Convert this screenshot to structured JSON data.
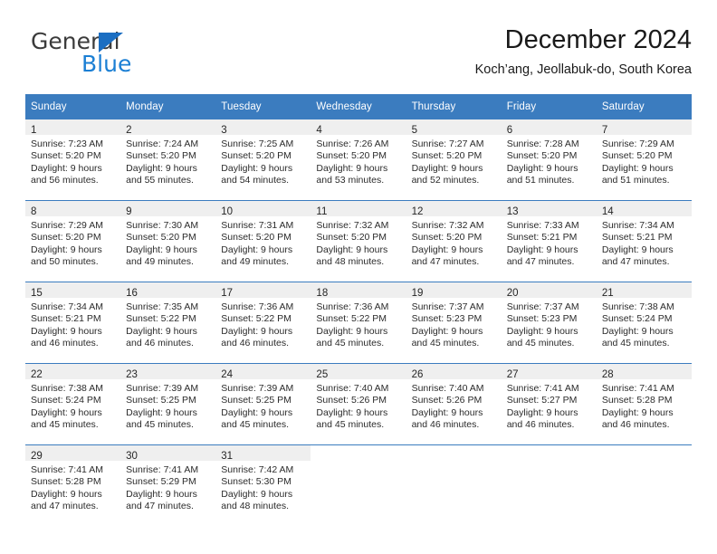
{
  "brand": {
    "name_part1": "General",
    "name_part2": "Blue",
    "triangle_icon": "triangle-icon"
  },
  "header": {
    "month_title": "December 2024",
    "location": "Koch’ang, Jeollabuk-do, South Korea"
  },
  "colors": {
    "header_blue": "#3b7cbf",
    "brand_blue": "#1b7fd4",
    "daynum_strip": "#efefef",
    "text": "#2b2b2b"
  },
  "calendar": {
    "weekday_headers": [
      "Sunday",
      "Monday",
      "Tuesday",
      "Wednesday",
      "Thursday",
      "Friday",
      "Saturday"
    ],
    "weeks": [
      [
        {
          "day": "1",
          "sunrise": "Sunrise: 7:23 AM",
          "sunset": "Sunset: 5:20 PM",
          "daylight1": "Daylight: 9 hours",
          "daylight2": "and 56 minutes."
        },
        {
          "day": "2",
          "sunrise": "Sunrise: 7:24 AM",
          "sunset": "Sunset: 5:20 PM",
          "daylight1": "Daylight: 9 hours",
          "daylight2": "and 55 minutes."
        },
        {
          "day": "3",
          "sunrise": "Sunrise: 7:25 AM",
          "sunset": "Sunset: 5:20 PM",
          "daylight1": "Daylight: 9 hours",
          "daylight2": "and 54 minutes."
        },
        {
          "day": "4",
          "sunrise": "Sunrise: 7:26 AM",
          "sunset": "Sunset: 5:20 PM",
          "daylight1": "Daylight: 9 hours",
          "daylight2": "and 53 minutes."
        },
        {
          "day": "5",
          "sunrise": "Sunrise: 7:27 AM",
          "sunset": "Sunset: 5:20 PM",
          "daylight1": "Daylight: 9 hours",
          "daylight2": "and 52 minutes."
        },
        {
          "day": "6",
          "sunrise": "Sunrise: 7:28 AM",
          "sunset": "Sunset: 5:20 PM",
          "daylight1": "Daylight: 9 hours",
          "daylight2": "and 51 minutes."
        },
        {
          "day": "7",
          "sunrise": "Sunrise: 7:29 AM",
          "sunset": "Sunset: 5:20 PM",
          "daylight1": "Daylight: 9 hours",
          "daylight2": "and 51 minutes."
        }
      ],
      [
        {
          "day": "8",
          "sunrise": "Sunrise: 7:29 AM",
          "sunset": "Sunset: 5:20 PM",
          "daylight1": "Daylight: 9 hours",
          "daylight2": "and 50 minutes."
        },
        {
          "day": "9",
          "sunrise": "Sunrise: 7:30 AM",
          "sunset": "Sunset: 5:20 PM",
          "daylight1": "Daylight: 9 hours",
          "daylight2": "and 49 minutes."
        },
        {
          "day": "10",
          "sunrise": "Sunrise: 7:31 AM",
          "sunset": "Sunset: 5:20 PM",
          "daylight1": "Daylight: 9 hours",
          "daylight2": "and 49 minutes."
        },
        {
          "day": "11",
          "sunrise": "Sunrise: 7:32 AM",
          "sunset": "Sunset: 5:20 PM",
          "daylight1": "Daylight: 9 hours",
          "daylight2": "and 48 minutes."
        },
        {
          "day": "12",
          "sunrise": "Sunrise: 7:32 AM",
          "sunset": "Sunset: 5:20 PM",
          "daylight1": "Daylight: 9 hours",
          "daylight2": "and 47 minutes."
        },
        {
          "day": "13",
          "sunrise": "Sunrise: 7:33 AM",
          "sunset": "Sunset: 5:21 PM",
          "daylight1": "Daylight: 9 hours",
          "daylight2": "and 47 minutes."
        },
        {
          "day": "14",
          "sunrise": "Sunrise: 7:34 AM",
          "sunset": "Sunset: 5:21 PM",
          "daylight1": "Daylight: 9 hours",
          "daylight2": "and 47 minutes."
        }
      ],
      [
        {
          "day": "15",
          "sunrise": "Sunrise: 7:34 AM",
          "sunset": "Sunset: 5:21 PM",
          "daylight1": "Daylight: 9 hours",
          "daylight2": "and 46 minutes."
        },
        {
          "day": "16",
          "sunrise": "Sunrise: 7:35 AM",
          "sunset": "Sunset: 5:22 PM",
          "daylight1": "Daylight: 9 hours",
          "daylight2": "and 46 minutes."
        },
        {
          "day": "17",
          "sunrise": "Sunrise: 7:36 AM",
          "sunset": "Sunset: 5:22 PM",
          "daylight1": "Daylight: 9 hours",
          "daylight2": "and 46 minutes."
        },
        {
          "day": "18",
          "sunrise": "Sunrise: 7:36 AM",
          "sunset": "Sunset: 5:22 PM",
          "daylight1": "Daylight: 9 hours",
          "daylight2": "and 45 minutes."
        },
        {
          "day": "19",
          "sunrise": "Sunrise: 7:37 AM",
          "sunset": "Sunset: 5:23 PM",
          "daylight1": "Daylight: 9 hours",
          "daylight2": "and 45 minutes."
        },
        {
          "day": "20",
          "sunrise": "Sunrise: 7:37 AM",
          "sunset": "Sunset: 5:23 PM",
          "daylight1": "Daylight: 9 hours",
          "daylight2": "and 45 minutes."
        },
        {
          "day": "21",
          "sunrise": "Sunrise: 7:38 AM",
          "sunset": "Sunset: 5:24 PM",
          "daylight1": "Daylight: 9 hours",
          "daylight2": "and 45 minutes."
        }
      ],
      [
        {
          "day": "22",
          "sunrise": "Sunrise: 7:38 AM",
          "sunset": "Sunset: 5:24 PM",
          "daylight1": "Daylight: 9 hours",
          "daylight2": "and 45 minutes."
        },
        {
          "day": "23",
          "sunrise": "Sunrise: 7:39 AM",
          "sunset": "Sunset: 5:25 PM",
          "daylight1": "Daylight: 9 hours",
          "daylight2": "and 45 minutes."
        },
        {
          "day": "24",
          "sunrise": "Sunrise: 7:39 AM",
          "sunset": "Sunset: 5:25 PM",
          "daylight1": "Daylight: 9 hours",
          "daylight2": "and 45 minutes."
        },
        {
          "day": "25",
          "sunrise": "Sunrise: 7:40 AM",
          "sunset": "Sunset: 5:26 PM",
          "daylight1": "Daylight: 9 hours",
          "daylight2": "and 45 minutes."
        },
        {
          "day": "26",
          "sunrise": "Sunrise: 7:40 AM",
          "sunset": "Sunset: 5:26 PM",
          "daylight1": "Daylight: 9 hours",
          "daylight2": "and 46 minutes."
        },
        {
          "day": "27",
          "sunrise": "Sunrise: 7:41 AM",
          "sunset": "Sunset: 5:27 PM",
          "daylight1": "Daylight: 9 hours",
          "daylight2": "and 46 minutes."
        },
        {
          "day": "28",
          "sunrise": "Sunrise: 7:41 AM",
          "sunset": "Sunset: 5:28 PM",
          "daylight1": "Daylight: 9 hours",
          "daylight2": "and 46 minutes."
        }
      ],
      [
        {
          "day": "29",
          "sunrise": "Sunrise: 7:41 AM",
          "sunset": "Sunset: 5:28 PM",
          "daylight1": "Daylight: 9 hours",
          "daylight2": "and 47 minutes."
        },
        {
          "day": "30",
          "sunrise": "Sunrise: 7:41 AM",
          "sunset": "Sunset: 5:29 PM",
          "daylight1": "Daylight: 9 hours",
          "daylight2": "and 47 minutes."
        },
        {
          "day": "31",
          "sunrise": "Sunrise: 7:42 AM",
          "sunset": "Sunset: 5:30 PM",
          "daylight1": "Daylight: 9 hours",
          "daylight2": "and 48 minutes."
        },
        null,
        null,
        null,
        null
      ]
    ]
  }
}
